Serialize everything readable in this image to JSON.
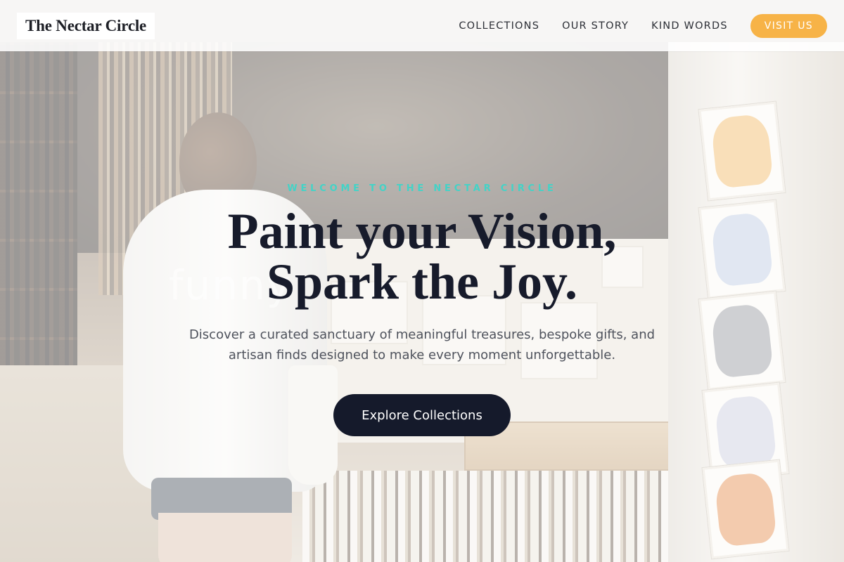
{
  "brand": {
    "name": "The Nectar Circle"
  },
  "nav": {
    "items": [
      {
        "label": "COLLECTIONS"
      },
      {
        "label": "OUR STORY"
      },
      {
        "label": "KIND WORDS"
      }
    ],
    "cta_label": "VISIT US"
  },
  "hero": {
    "eyebrow": "WELCOME TO THE NECTAR CIRCLE",
    "headline_line1": "Paint your Vision,",
    "headline_line2": "Spark the Joy.",
    "subtext": "Discover a curated sanctuary of meaningful treasures, bespoke gifts, and artisan finds designed to make every moment unforgettable.",
    "cta_label": "Explore Collections",
    "background_watermark": "funny"
  },
  "colors": {
    "accent_teal": "#43d3c7",
    "accent_orange": "#f7b347",
    "navy": "#151a2b"
  }
}
